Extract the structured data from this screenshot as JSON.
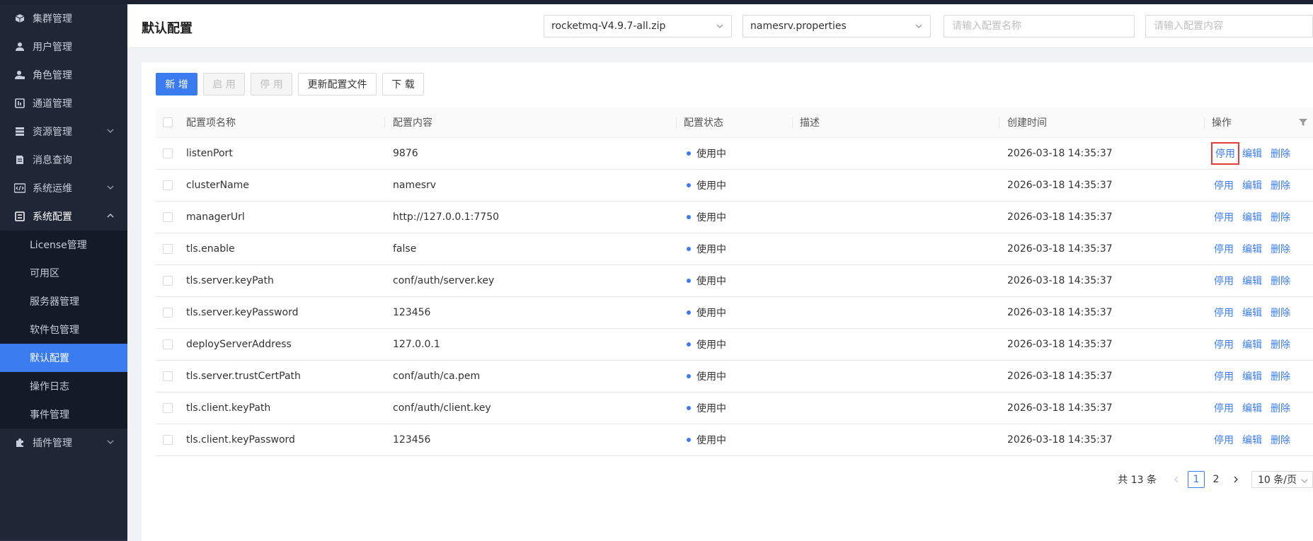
{
  "sidebar": {
    "items": [
      {
        "label": "集群管理",
        "icon": "cube-icon"
      },
      {
        "label": "用户管理",
        "icon": "user-icon"
      },
      {
        "label": "角色管理",
        "icon": "role-icon"
      },
      {
        "label": "通道管理",
        "icon": "channel-icon"
      },
      {
        "label": "资源管理",
        "icon": "resource-icon"
      },
      {
        "label": "消息查询",
        "icon": "message-icon"
      },
      {
        "label": "系统运维",
        "icon": "code-icon"
      },
      {
        "label": "系统配置",
        "icon": "config-icon"
      },
      {
        "label": "插件管理",
        "icon": "plugin-icon"
      }
    ],
    "submenu": [
      {
        "label": "License管理"
      },
      {
        "label": "可用区"
      },
      {
        "label": "服务器管理"
      },
      {
        "label": "软件包管理"
      },
      {
        "label": "默认配置"
      },
      {
        "label": "操作日志"
      },
      {
        "label": "事件管理"
      }
    ]
  },
  "header": {
    "title": "默认配置",
    "package_select": "rocketmq-V4.9.7-all.zip",
    "file_select": "namesrv.properties",
    "name_placeholder": "请输入配置名称",
    "content_placeholder": "请输入配置内容"
  },
  "toolbar": {
    "add": "新 增",
    "enable": "启 用",
    "disable": "停 用",
    "update_file": "更新配置文件",
    "download": "下 载"
  },
  "table": {
    "columns": {
      "name": "配置项名称",
      "content": "配置内容",
      "status": "配置状态",
      "desc": "描述",
      "created": "创建时间",
      "actions": "操作"
    },
    "rows": [
      {
        "name": "listenPort",
        "content": "9876",
        "status": "使用中",
        "desc": "",
        "created": "2026-03-18 14:35:37"
      },
      {
        "name": "clusterName",
        "content": "namesrv",
        "status": "使用中",
        "desc": "",
        "created": "2026-03-18 14:35:37"
      },
      {
        "name": "managerUrl",
        "content": "http://127.0.0.1:7750",
        "status": "使用中",
        "desc": "",
        "created": "2026-03-18 14:35:37"
      },
      {
        "name": "tls.enable",
        "content": "false",
        "status": "使用中",
        "desc": "",
        "created": "2026-03-18 14:35:37"
      },
      {
        "name": "tls.server.keyPath",
        "content": "conf/auth/server.key",
        "status": "使用中",
        "desc": "",
        "created": "2026-03-18 14:35:37"
      },
      {
        "name": "tls.server.keyPassword",
        "content": "123456",
        "status": "使用中",
        "desc": "",
        "created": "2026-03-18 14:35:37"
      },
      {
        "name": "deployServerAddress",
        "content": "127.0.0.1",
        "status": "使用中",
        "desc": "",
        "created": "2026-03-18 14:35:37"
      },
      {
        "name": "tls.server.trustCertPath",
        "content": "conf/auth/ca.pem",
        "status": "使用中",
        "desc": "",
        "created": "2026-03-18 14:35:37"
      },
      {
        "name": "tls.client.keyPath",
        "content": "conf/auth/client.key",
        "status": "使用中",
        "desc": "",
        "created": "2026-03-18 14:35:37"
      },
      {
        "name": "tls.client.keyPassword",
        "content": "123456",
        "status": "使用中",
        "desc": "",
        "created": "2026-03-18 14:35:37"
      }
    ],
    "action_labels": {
      "disable": "停用",
      "edit": "编辑",
      "delete": "删除"
    }
  },
  "pagination": {
    "total": "共 13 条",
    "pages": [
      "1",
      "2"
    ],
    "current": "1",
    "page_size": "10 条/页"
  },
  "colors": {
    "accent": "#3a7cf0",
    "sidebar_bg": "#1f2636",
    "highlight_box": "#e83a3a"
  }
}
